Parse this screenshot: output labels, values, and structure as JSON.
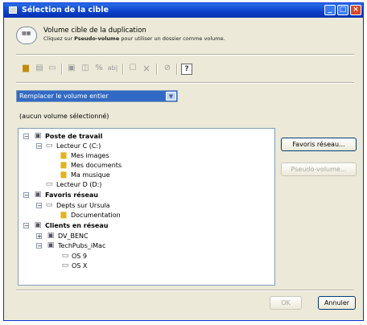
{
  "window": {
    "title": "Sélection de la cible"
  },
  "header": {
    "title": "Volume cible de la duplication",
    "subtitle_prefix": "Cliquez sur ",
    "subtitle_bold": "Pseudo-volume",
    "subtitle_suffix": " pour utiliser un dossier comme volume."
  },
  "toolbar": {
    "help_glyph": "?"
  },
  "mode_select": {
    "selected": "Remplacer le volume entier"
  },
  "status": "(aucun volume sélectionné)",
  "tree": {
    "poste": "Poste de travail",
    "lecteur_c": "Lecteur C (C:)",
    "mes_images": "Mes images",
    "mes_documents": "Mes documents",
    "ma_musique": "Ma musique",
    "lecteur_d": "Lecteur D (D:)",
    "favoris": "Favoris réseau",
    "depts": "Depts sur Ursula",
    "documentation": "Documentation",
    "clients": "Clients en réseau",
    "dv_benc": "DV_BENC",
    "techpubs": "TechPubs_iMac",
    "os9": "OS 9",
    "osx": "OS X"
  },
  "buttons": {
    "favoris": "Favoris réseau...",
    "pseudo": "Pseudo-volume...",
    "ok": "OK",
    "annuler": "Annuler"
  }
}
